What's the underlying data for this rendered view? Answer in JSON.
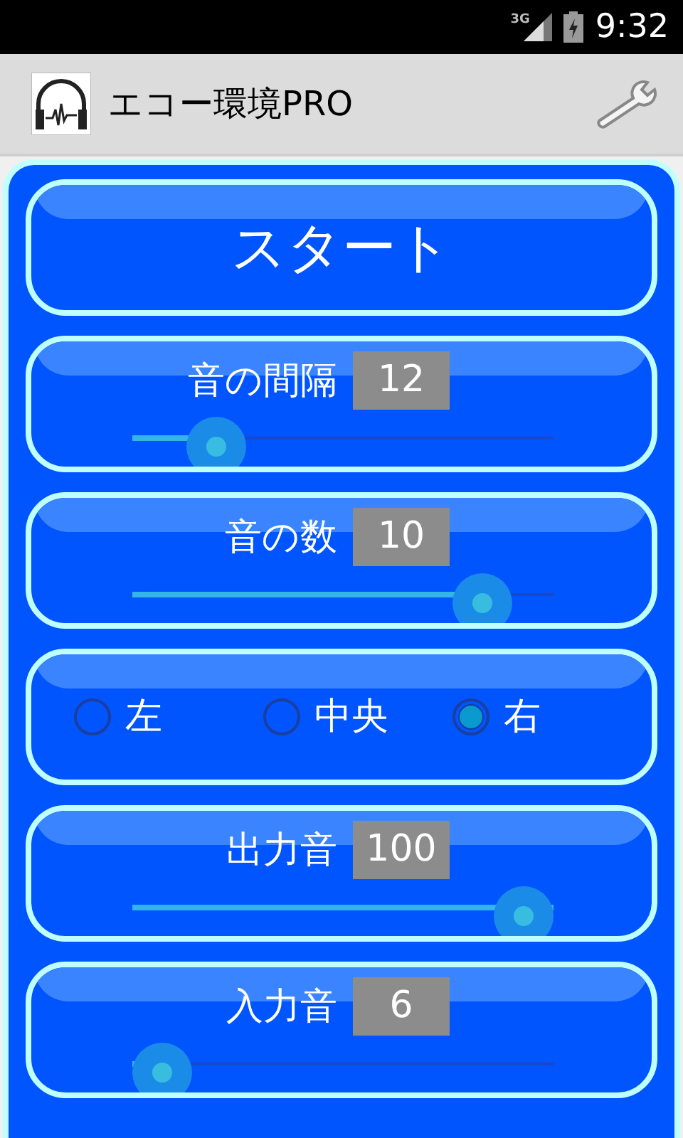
{
  "status_bar": {
    "network": "3G",
    "time": "9:32"
  },
  "action_bar": {
    "title": "エコー環境PRO"
  },
  "start_button": {
    "label": "スタート"
  },
  "rows": [
    {
      "kind": "slider",
      "label": "音の間隔",
      "value": "12",
      "level": 0.2
    },
    {
      "kind": "slider",
      "label": "音の数",
      "value": "10",
      "level": 0.83
    },
    {
      "kind": "radio",
      "options": [
        {
          "label": "左",
          "selected": false
        },
        {
          "label": "中央",
          "selected": false
        },
        {
          "label": "右",
          "selected": true
        }
      ]
    },
    {
      "kind": "slider",
      "label": "出力音",
      "value": "100",
      "level": 1.0
    },
    {
      "kind": "slider",
      "label": "入力音",
      "value": "6",
      "level": 0.06
    }
  ]
}
